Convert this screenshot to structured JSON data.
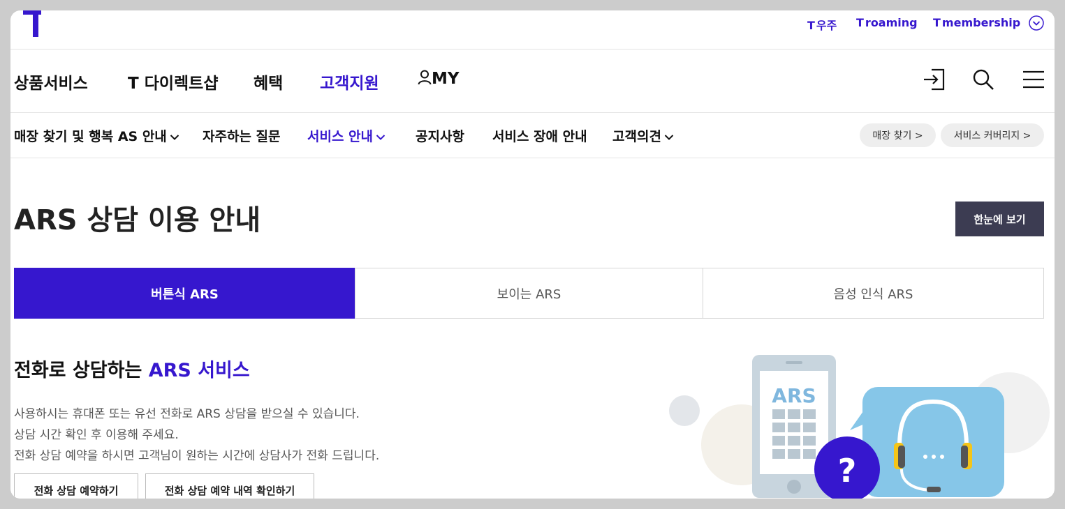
{
  "utility_links": [
    {
      "t": "T",
      "label": "우주"
    },
    {
      "t": "T",
      "label": "roaming"
    },
    {
      "t": "T",
      "label": "membership"
    }
  ],
  "gnb": {
    "items": [
      "상품서비스",
      "T 다이렉트샵",
      "혜택",
      "고객지원"
    ],
    "my_label": "MY"
  },
  "subnav": {
    "items": [
      "매장 찾기 및 행복 AS 안내",
      "자주하는 질문",
      "서비스 안내",
      "공지사항",
      "서비스 장애 안내",
      "고객의견"
    ],
    "pills": [
      "매장 찾기 >",
      "서비스 커버리지 >"
    ]
  },
  "page": {
    "title": "ARS 상담 이용 안내",
    "overview_button": "한눈에 보기"
  },
  "tabs": [
    "버튼식 ARS",
    "보이는 ARS",
    "음성 인식 ARS"
  ],
  "section": {
    "heading_prefix": "전화로 상담하는 ",
    "heading_highlight": "ARS 서비스",
    "lines": [
      "사용하시는 휴대폰 또는 유선 전화로 ARS 상담을 받으실 수 있습니다.",
      "상담 시간 확인 후 이용해 주세요.",
      "전화 상담 예약을 하시면 고객님이 원하는 시간에 상담사가 전화 드립니다."
    ],
    "buttons": [
      "전화 상담 예약하기",
      "전화 상담 예약 내역 확인하기"
    ]
  },
  "illustration": {
    "phone_text": "ARS",
    "question_mark": "?"
  },
  "colors": {
    "brand": "#3617ce",
    "dark_button": "#3c3c52",
    "bubble": "#86c6e8",
    "phone": "#c5d3dd",
    "headset": "#f5c518"
  }
}
